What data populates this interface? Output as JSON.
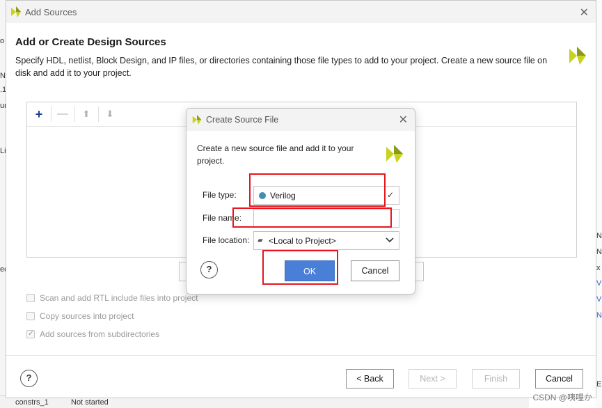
{
  "background": {
    "left_chars": [
      "o",
      "N",
      ".1",
      "ur",
      "Li",
      "ec"
    ],
    "right_chars": [
      "N",
      "N",
      "x",
      "V",
      "V",
      "N",
      "E"
    ],
    "bottom_cells": [
      "constrs_1",
      "Not started"
    ]
  },
  "dialog": {
    "window_title": "Add Sources",
    "heading": "Add or Create Design Sources",
    "description": "Specify HDL, netlist, Block Design, and IP files, or directories containing those file types to add to your project. Create a new source file on disk and add it to your project.",
    "toolbar_icons": [
      "add-icon",
      "remove-icon",
      "move-up-icon",
      "move-down-icon"
    ],
    "options": [
      {
        "label": "Scan and add RTL include files into project",
        "checked": false
      },
      {
        "label": "Copy sources into project",
        "checked": false
      },
      {
        "label": "Add sources from subdirectories",
        "checked": true
      }
    ],
    "buttons": {
      "help": "?",
      "back": "< Back",
      "next": "Next >",
      "finish": "Finish",
      "cancel": "Cancel"
    }
  },
  "modal": {
    "title": "Create Source File",
    "description": "Create a new source file and add it to your project.",
    "file_type_label": "File type:",
    "file_type_value": "Verilog",
    "file_type_dot_color": "#3f8fb0",
    "file_name_label": "File name:",
    "file_name_value": "",
    "file_location_label": "File location:",
    "file_location_value": "<Local to Project>",
    "help": "?",
    "ok": "OK",
    "cancel": "Cancel"
  },
  "colors": {
    "accent": "#4a7fd8",
    "highlight": "#e8141f",
    "logo_yellow": "#c9d21f",
    "logo_olive": "#8a9a1b"
  },
  "watermark": "CSDN @咦哩か"
}
